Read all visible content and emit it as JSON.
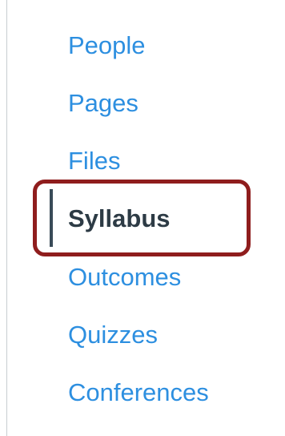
{
  "course_nav": {
    "items": [
      {
        "label": "People",
        "active": false
      },
      {
        "label": "Pages",
        "active": false
      },
      {
        "label": "Files",
        "active": false
      },
      {
        "label": "Syllabus",
        "active": true
      },
      {
        "label": "Outcomes",
        "active": false
      },
      {
        "label": "Quizzes",
        "active": false
      },
      {
        "label": "Conferences",
        "active": false
      }
    ]
  },
  "colors": {
    "link": "#2d8fe0",
    "active_text": "#2d3b45",
    "active_indicator": "#394b58",
    "highlight_outline": "#8f1d1d"
  }
}
